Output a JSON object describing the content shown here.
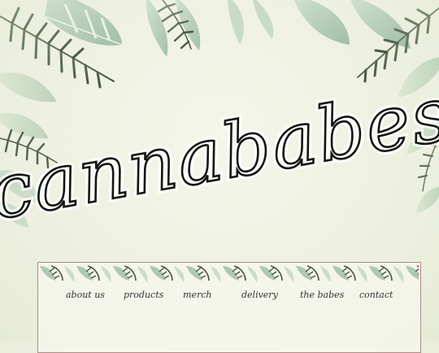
{
  "brand": {
    "logo_text": "cannababes"
  },
  "nav": {
    "items": [
      {
        "label": "about us"
      },
      {
        "label": "products"
      },
      {
        "label": "merch"
      },
      {
        "label": "delivery"
      },
      {
        "label": "the babes"
      },
      {
        "label": "contact"
      }
    ]
  },
  "colors": {
    "background": "#eef1e1",
    "ink": "#121512",
    "frame": "#b28d86",
    "leaf_light": "#a9c4ad",
    "leaf_dark": "#4e5e48"
  }
}
